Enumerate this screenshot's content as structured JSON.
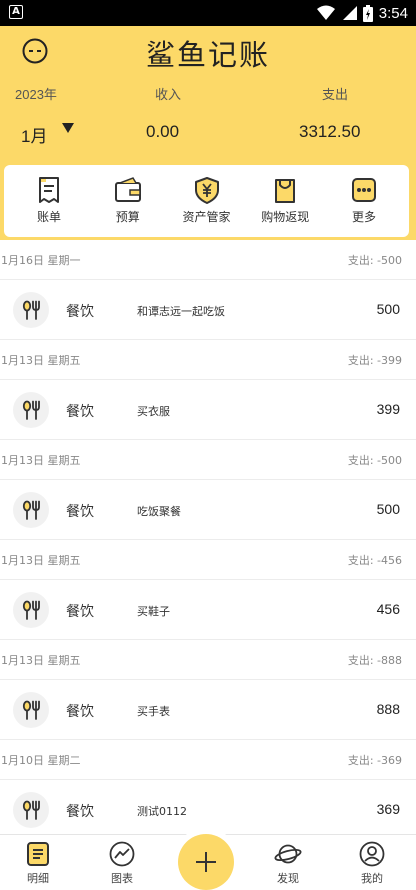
{
  "status_bar": {
    "time": "3:54",
    "notification_glyph": "A",
    "icons": [
      "wifi-icon",
      "signal-icon",
      "battery-icon"
    ]
  },
  "header": {
    "title": "鲨鱼记账",
    "year_label": "2023年",
    "month": "1月",
    "income_label": "收入",
    "income_value": "0.00",
    "expense_label": "支出",
    "expense_value": "3312.50",
    "accent_color": "#fcd968"
  },
  "shortcuts": [
    {
      "label": "账单",
      "icon": "bill-icon"
    },
    {
      "label": "预算",
      "icon": "wallet-icon"
    },
    {
      "label": "资产管家",
      "icon": "shield-yen-icon"
    },
    {
      "label": "购物返现",
      "icon": "shopping-bag-icon"
    },
    {
      "label": "更多",
      "icon": "more-icon"
    }
  ],
  "entries": [
    {
      "date": "1月16日 星期一",
      "day_summary": "支出: -500",
      "category": "餐饮",
      "note": "和谭志远一起吃饭",
      "amount": "500",
      "icon": "dining-icon"
    },
    {
      "date": "1月13日 星期五",
      "day_summary": "支出: -399",
      "category": "餐饮",
      "note": "买衣服",
      "amount": "399",
      "icon": "dining-icon"
    },
    {
      "date": "1月13日 星期五",
      "day_summary": "支出: -500",
      "category": "餐饮",
      "note": "吃饭聚餐",
      "amount": "500",
      "icon": "dining-icon"
    },
    {
      "date": "1月13日 星期五",
      "day_summary": "支出: -456",
      "category": "餐饮",
      "note": "买鞋子",
      "amount": "456",
      "icon": "dining-icon"
    },
    {
      "date": "1月13日 星期五",
      "day_summary": "支出: -888",
      "category": "餐饮",
      "note": "买手表",
      "amount": "888",
      "icon": "dining-icon"
    },
    {
      "date": "1月10日 星期二",
      "day_summary": "支出: -369",
      "category": "餐饮",
      "note": "测试0112",
      "amount": "369",
      "icon": "dining-icon"
    }
  ],
  "bottom_nav": [
    {
      "label": "明细",
      "icon": "details-icon"
    },
    {
      "label": "图表",
      "icon": "chart-icon"
    },
    {
      "label": "发现",
      "icon": "planet-icon"
    },
    {
      "label": "我的",
      "icon": "profile-icon"
    }
  ],
  "add_button_icon": "plus-icon"
}
